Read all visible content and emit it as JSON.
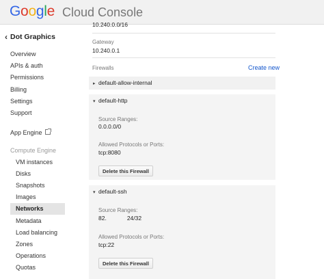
{
  "header": {
    "logo_letters": [
      {
        "ch": "G",
        "color": "#3366e6"
      },
      {
        "ch": "o",
        "color": "#dd3a2b"
      },
      {
        "ch": "o",
        "color": "#f2b31a"
      },
      {
        "ch": "g",
        "color": "#3366e6"
      },
      {
        "ch": "l",
        "color": "#23a455"
      },
      {
        "ch": "e",
        "color": "#dd3a2b"
      }
    ],
    "product": "Cloud Console"
  },
  "sidebar": {
    "project": "Dot Graphics",
    "items": [
      {
        "label": "Overview"
      },
      {
        "label": "APIs & auth"
      },
      {
        "label": "Permissions"
      },
      {
        "label": "Billing"
      },
      {
        "label": "Settings"
      },
      {
        "label": "Support"
      },
      {
        "label": "App Engine"
      },
      {
        "label": "Compute Engine"
      },
      {
        "label": "VM instances"
      },
      {
        "label": "Disks"
      },
      {
        "label": "Snapshots"
      },
      {
        "label": "Images"
      },
      {
        "label": "Networks"
      },
      {
        "label": "Metadata"
      },
      {
        "label": "Load balancing"
      },
      {
        "label": "Zones"
      },
      {
        "label": "Operations"
      },
      {
        "label": "Quotas"
      }
    ]
  },
  "main": {
    "top_range": "10.240.0.0/16",
    "gateway_label": "Gateway",
    "gateway_value": "10.240.0.1",
    "firewalls_label": "Firewalls",
    "create_new": "Create new",
    "firewalls": [
      {
        "name": "default-allow-internal",
        "expanded": false
      },
      {
        "name": "default-http",
        "expanded": true,
        "source_label": "Source Ranges:",
        "source_value": "0.0.0.0/0",
        "proto_label": "Allowed Protocols or Ports:",
        "proto_value": "tcp:8080",
        "delete_label": "Delete this Firewall"
      },
      {
        "name": "default-ssh",
        "expanded": true,
        "source_label": "Source Ranges:",
        "source_prefix": "82.",
        "source_suffix": "24/32",
        "proto_label": "Allowed Protocols or Ports:",
        "proto_value": "tcp:22",
        "delete_label": "Delete this Firewall"
      }
    ]
  }
}
